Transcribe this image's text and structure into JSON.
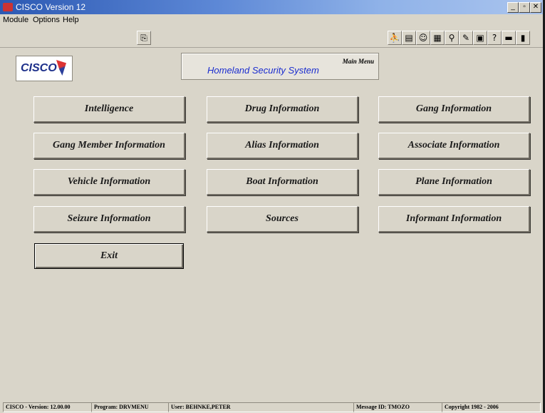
{
  "window": {
    "title": "CISCO Version 12",
    "minimize": "_",
    "restore": "▫",
    "close": "✕"
  },
  "menu": [
    "Module",
    "Options",
    "Help"
  ],
  "toolbar": {
    "icons": [
      "open-icon",
      "exit-person-icon",
      "notes-icon",
      "smiley-icon",
      "picture-icon",
      "magnifier-icon",
      "edit-icon",
      "calculator-icon",
      "help-icon",
      "folder-icon",
      "door-icon"
    ]
  },
  "logo": {
    "text": "CISCO"
  },
  "header": {
    "main_menu": "Main Menu",
    "system": "Homeland Security System"
  },
  "buttons": [
    "Intelligence",
    "Drug Information",
    "Gang Information",
    "Gang Member Information",
    "Alias Information",
    "Associate Information",
    "Vehicle Information",
    "Boat Information",
    "Plane Information",
    "Seizure Information",
    "Sources",
    "Informant Information",
    "Exit"
  ],
  "status": {
    "version": "CISCO - Version: 12.00.00",
    "program": "Program: DRVMENU",
    "user": "User: BEHNKE,PETER",
    "message": "Message ID: TMOZO",
    "copyright": "Copyright 1982 - 2006"
  }
}
